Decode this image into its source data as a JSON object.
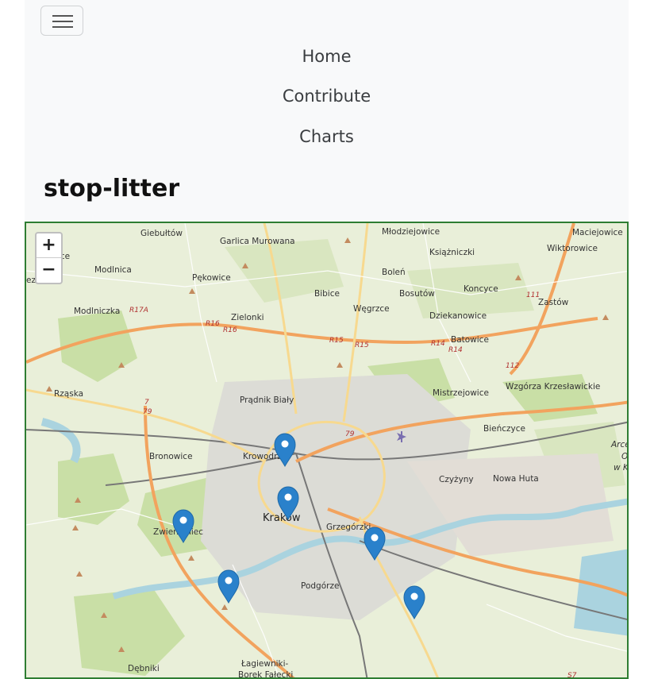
{
  "navbar": {
    "toggler_icon": "hamburger-icon",
    "links": [
      "Home",
      "Contribute",
      "Charts"
    ],
    "brand": "stop-litter"
  },
  "map": {
    "zoom_in": "+",
    "zoom_out": "−",
    "marker_icon": "map-marker-icon",
    "border_color": "#2e7d32",
    "marker_color": "#2a81cb",
    "place_labels": [
      "Giebułtów",
      "Garlica Murowana",
      "Młodziejowice",
      "Maciejowice",
      "szowice",
      "Modlnica",
      "Książniczki",
      "Wiktorowice",
      "Pękowice",
      "Boleń",
      "Koncyce",
      "ezie",
      "Modlniczka",
      "Bibice",
      "Bosutów",
      "Zastów",
      "Zielonki",
      "Węgrzce",
      "Dziekanowice",
      "Batowice",
      "Wzgórza Krzesławickie",
      "Rząska",
      "Prądnik Biały",
      "Mistrzejowice",
      "Bieńczyce",
      "Arce",
      "O",
      "w K",
      "Bronowice",
      "Krowodrza",
      "Czyżyny",
      "Nowa Huta",
      "Kraków",
      "Zwierzyniec",
      "Grzegórzki",
      "Podgórze",
      "Dębniki",
      "Łagiewniki-",
      "Borek Fałęcki"
    ],
    "road_labels": [
      "R17A",
      "R16",
      "R16",
      "R15",
      "R15",
      "R14",
      "R14",
      "111",
      "112",
      "7",
      "79",
      "79",
      "S7"
    ]
  }
}
